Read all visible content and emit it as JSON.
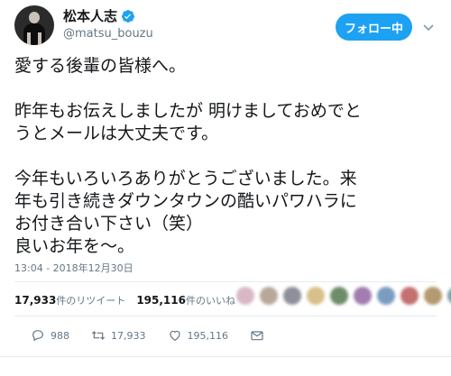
{
  "user": {
    "display_name": "松本人志",
    "handle": "@matsu_bouzu",
    "verified": true
  },
  "follow_button": {
    "label": "フォロー中"
  },
  "tweet": {
    "text": "愛する後輩の皆様へ。\n\n昨年もお伝えしましたが 明けましておめでと\nうとメールは大丈夫です。\n\n今年もいろいろありがとうございました。来\n年も引き続きダウンタウンの酷いパワハラに\nお付き合い下さい（笑）\n良いお年を〜。",
    "timestamp": "13:04 - 2018年12月30日"
  },
  "stats": {
    "retweets_count": "17,933",
    "retweets_label": "件のリツイート",
    "likes_count": "195,116",
    "likes_label": "件のいいね"
  },
  "liker_avatars": [
    "#d9b8c6",
    "#b9a89a",
    "#8f8f9a",
    "#d8c08a",
    "#6f8c6a",
    "#a07cb0",
    "#7a9cc0",
    "#c47070",
    "#b59a70",
    "#7fa0a0"
  ],
  "actions": {
    "reply_count": "988",
    "retweet_count": "17,933",
    "like_count": "195,116"
  },
  "colors": {
    "accent": "#1da1f2",
    "muted": "#657786",
    "text": "#14171a"
  }
}
